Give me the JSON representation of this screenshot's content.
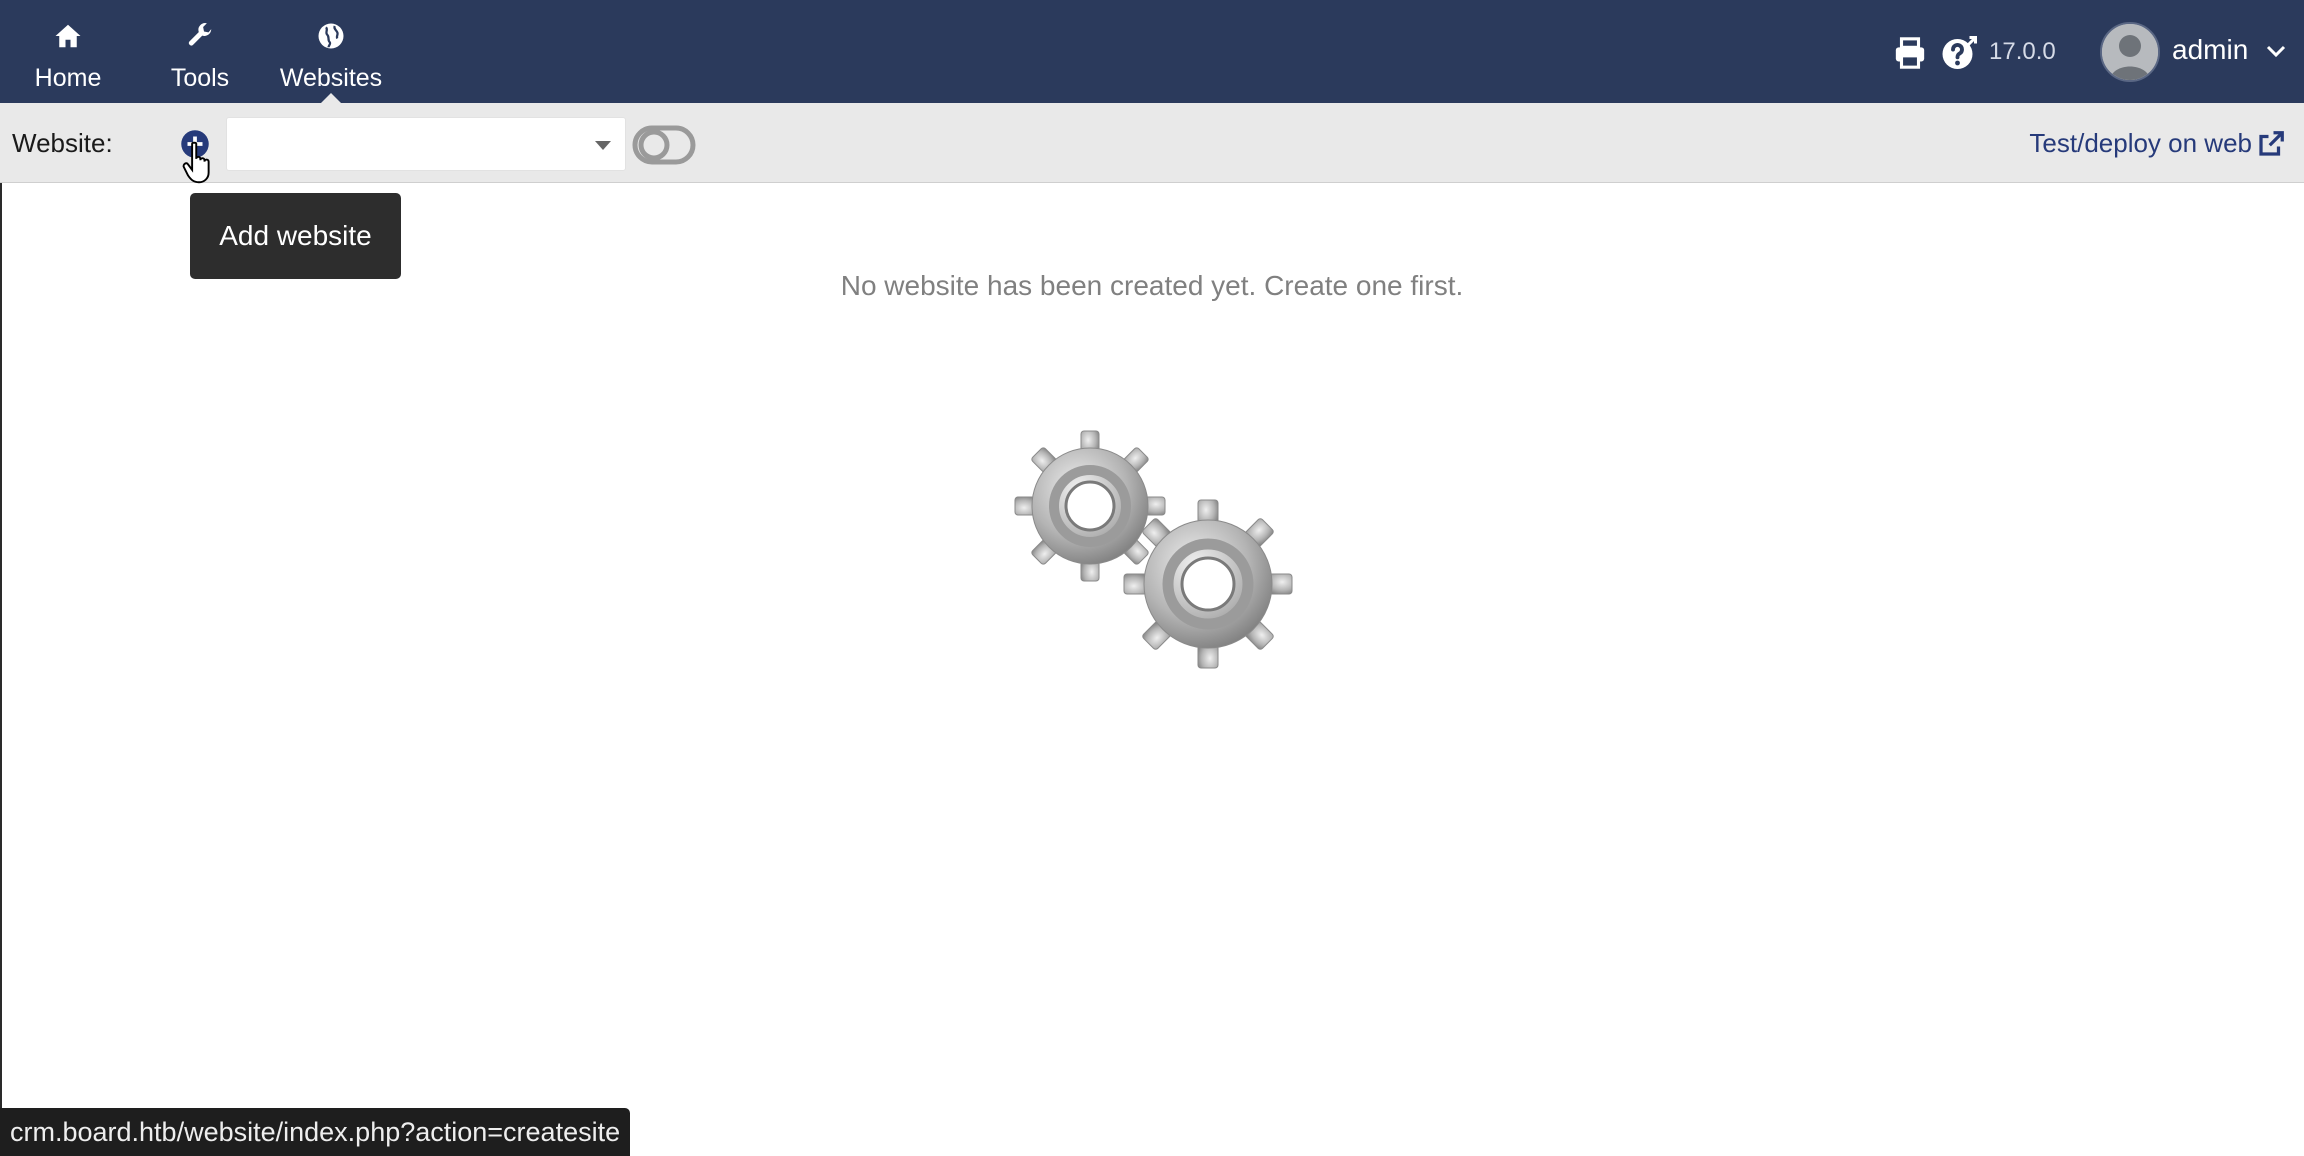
{
  "nav": {
    "items": [
      {
        "label": "Home",
        "icon": "home-icon"
      },
      {
        "label": "Tools",
        "icon": "wrench-icon"
      },
      {
        "label": "Websites",
        "icon": "globe-icon"
      }
    ],
    "active": "Websites"
  },
  "header": {
    "version": "17.0.0",
    "user_name": "admin",
    "icons": [
      "print-icon",
      "help-icon",
      "avatar",
      "chevron-down-icon"
    ]
  },
  "toolbar": {
    "website_label": "Website:",
    "add_icon": "plus-circle-icon",
    "select_value": "",
    "toggle_icon": "toggle-off-icon",
    "deploy_link": "Test/deploy on web",
    "deploy_icon": "external-link-icon"
  },
  "tooltip": {
    "text": "Add website"
  },
  "main": {
    "empty_message": "No website has been created yet. Create one first.",
    "illustration": "gears-icon"
  },
  "status_bar": {
    "url": "crm.board.htb/website/index.php?action=createsite"
  },
  "colors": {
    "topbar": "#2b3a5c",
    "toolbar": "#e9e9e9",
    "link": "#263a7a",
    "tooltip_bg": "#2d2d2d",
    "message_text": "#808080"
  }
}
